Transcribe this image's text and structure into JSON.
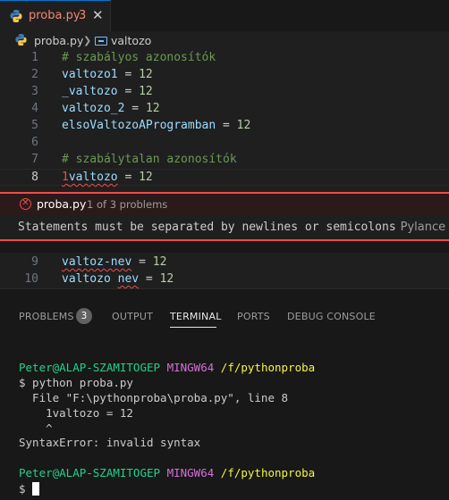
{
  "tab": {
    "filename": "proba.py",
    "problem_count": "3",
    "close_glyph": "✕"
  },
  "breadcrumb": {
    "file": "proba.py",
    "separator": "❯",
    "symbol": "valtozo"
  },
  "editor": {
    "lines": [
      {
        "num": "1",
        "comment": "# szabályos azonosítók"
      },
      {
        "num": "2",
        "name": "valtozo1",
        "op": " = ",
        "value": "12"
      },
      {
        "num": "3",
        "name": "_valtozo",
        "op": " = ",
        "value": "12"
      },
      {
        "num": "4",
        "name": "valtozo_2",
        "op": " = ",
        "value": "12"
      },
      {
        "num": "5",
        "name": "elsoValtozoAProgramban",
        "op": " = ",
        "value": "12"
      },
      {
        "num": "6"
      },
      {
        "num": "7",
        "comment": "# szabálytalan azonosítók"
      },
      {
        "num": "8",
        "err_char": "1",
        "name": "valtozo",
        "op": " = ",
        "value": "12"
      }
    ],
    "after_peek": [
      {
        "num": "9",
        "name": "valtoz-nev",
        "op": " = ",
        "value": "12"
      },
      {
        "num": "10",
        "name1": "valtozo",
        "space": " ",
        "name2": "nev",
        "op": " = ",
        "value": "12"
      }
    ]
  },
  "peek": {
    "file": "proba.py",
    "count": "1 of 3 problems",
    "message": "Statements must be separated by newlines or semicolons",
    "source": "Pylance"
  },
  "panel": {
    "tabs": {
      "problems": "PROBLEMS",
      "problems_badge": "3",
      "output": "OUTPUT",
      "terminal": "TERMINAL",
      "ports": "PORTS",
      "debug": "DEBUG CONSOLE"
    },
    "terminal": {
      "prompt_user": "Peter@ALAP-SZAMITOGEP",
      "prompt_shell": "MINGW64",
      "prompt_path": "/f/pythonproba",
      "cmd": "$ python proba.py",
      "tb1": "  File \"F:\\pythonproba\\proba.py\", line 8",
      "tb2": "    1valtozo = 12",
      "tb3": "    ^",
      "tb4": "SyntaxError: invalid syntax",
      "prompt_char": "$ "
    }
  },
  "colors": {
    "error": "#f14c4c",
    "accent": "#0078d4",
    "comment": "#6a9955",
    "variable": "#9cdcfe",
    "number": "#b5cea8"
  }
}
